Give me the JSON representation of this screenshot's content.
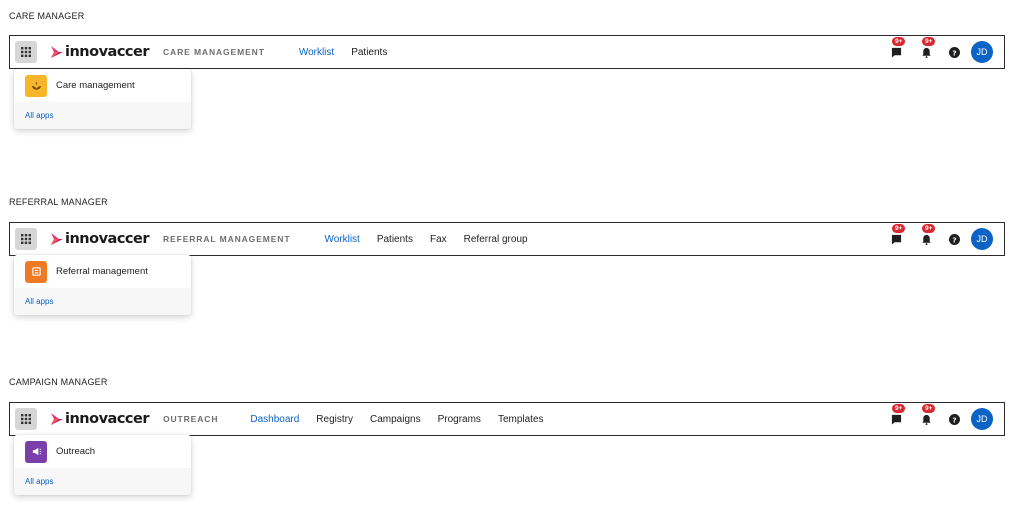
{
  "brand": {
    "logo_text": "innovaccer"
  },
  "colors": {
    "accent_blue": "#0b63c5",
    "badge_red": "#d9282f",
    "care_icon_bg": "#f7b52a",
    "referral_icon_bg": "#ee7a26",
    "outreach_icon_bg": "#7a3fa8"
  },
  "sections": [
    {
      "title": "CARE MANAGER",
      "product": "CARE MANAGEMENT",
      "nav": [
        "Worklist",
        "Patients"
      ],
      "active_nav": "Worklist",
      "badges": {
        "messages": "9+",
        "notifications": "9+"
      },
      "avatar": "JD",
      "app": {
        "label": "Care management",
        "icon": "leaf-hand-icon"
      },
      "all_apps": "All apps"
    },
    {
      "title": "REFERRAL MANAGER",
      "product": "REFERRAL MANAGEMENT",
      "nav": [
        "Worklist",
        "Patients",
        "Fax",
        "Referral group"
      ],
      "active_nav": "Worklist",
      "badges": {
        "messages": "9+",
        "notifications": "9+"
      },
      "avatar": "JD",
      "app": {
        "label": "Referral management",
        "icon": "referral-list-icon"
      },
      "all_apps": "All apps"
    },
    {
      "title": "CAMPAIGN MANAGER",
      "product": "OUTREACH",
      "nav": [
        "Dashboard",
        "Registry",
        "Campaigns",
        "Programs",
        "Templates"
      ],
      "active_nav": "Dashboard",
      "badges": {
        "messages": "9+",
        "notifications": "9+"
      },
      "avatar": "JD",
      "app": {
        "label": "Outreach",
        "icon": "megaphone-icon"
      },
      "all_apps": "All apps"
    }
  ]
}
